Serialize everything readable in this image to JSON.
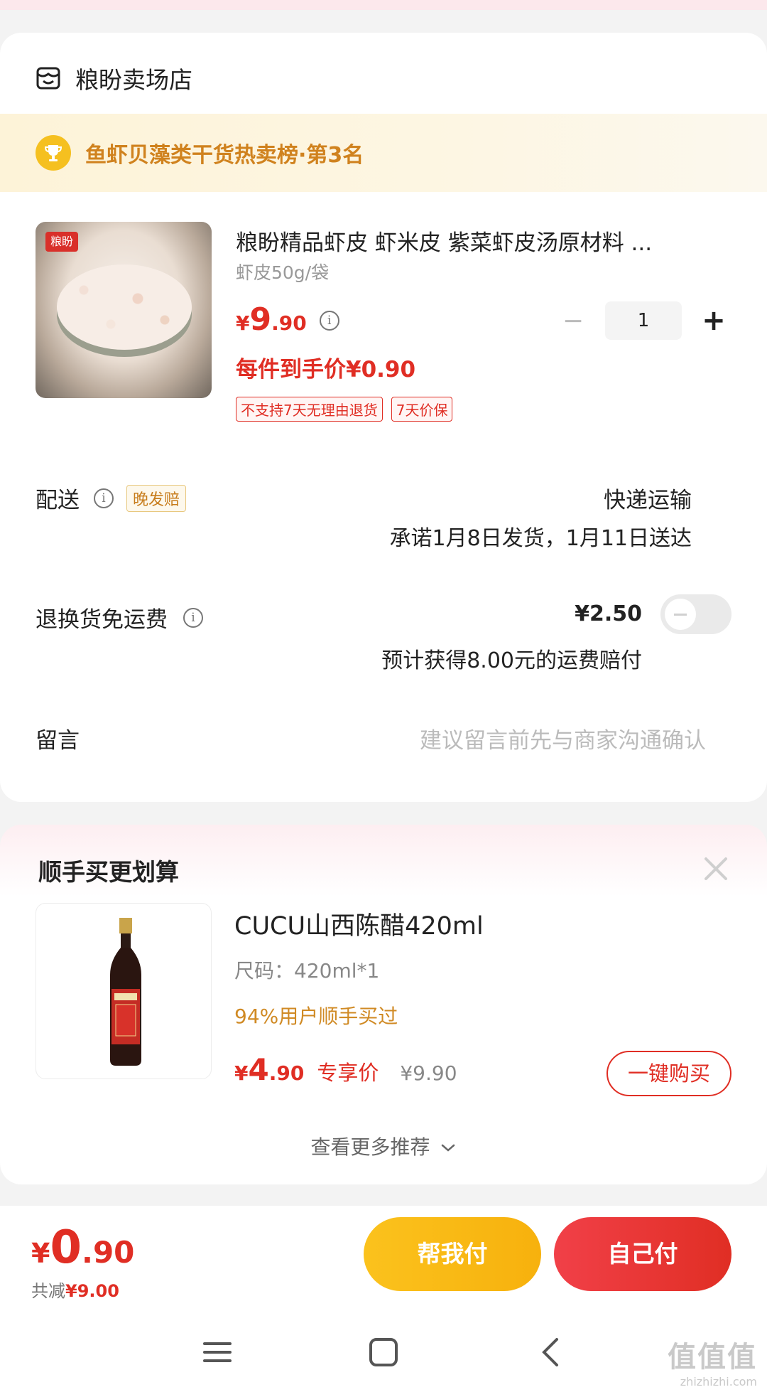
{
  "store": {
    "name": "粮盼卖场店",
    "rank_text": "鱼虾贝藻类干货热卖榜·第3名"
  },
  "product": {
    "brand_tag": "粮盼",
    "title": "粮盼精品虾皮 虾米皮 紫菜虾皮汤原材料 ...",
    "spec": "虾皮50g/袋",
    "price_currency": "¥",
    "price_int": "9",
    "price_dec": ".90",
    "quantity": "1",
    "final_price": "每件到手价¥0.90",
    "tags": [
      "不支持7天无理由退货",
      "7天价保"
    ]
  },
  "shipping": {
    "label": "配送",
    "late_badge": "晚发赔",
    "method": "快递运输",
    "promise": "承诺1月8日发货，1月11日送达"
  },
  "return_shipping": {
    "label": "退换货免运费",
    "price": "¥2.50",
    "note": "预计获得8.00元的运费赔付",
    "enabled": false
  },
  "message": {
    "label": "留言",
    "placeholder": "建议留言前先与商家沟通确认"
  },
  "recommend": {
    "title": "顺手买更划算",
    "item": {
      "name": "CUCU山西陈醋420ml",
      "size": "尺码：420ml*1",
      "stat": "94%用户顺手买过",
      "price_currency": "¥",
      "price_int": "4",
      "price_dec": ".90",
      "exclusive": "专享价",
      "original": "¥9.90",
      "buy_label": "一键购买"
    },
    "more": "查看更多推荐"
  },
  "checkout": {
    "currency": "¥",
    "total_int": "0",
    "total_dec": ".90",
    "saved_prefix": "共减",
    "saved_amount": "¥9.00",
    "help_pay": "帮我付",
    "self_pay": "自己付"
  },
  "watermark": {
    "big": "值值值",
    "small": "zhizhizhi.com"
  },
  "colors": {
    "accent": "#e02e24",
    "gold": "#f7b10d",
    "rank": "#d0821e"
  }
}
